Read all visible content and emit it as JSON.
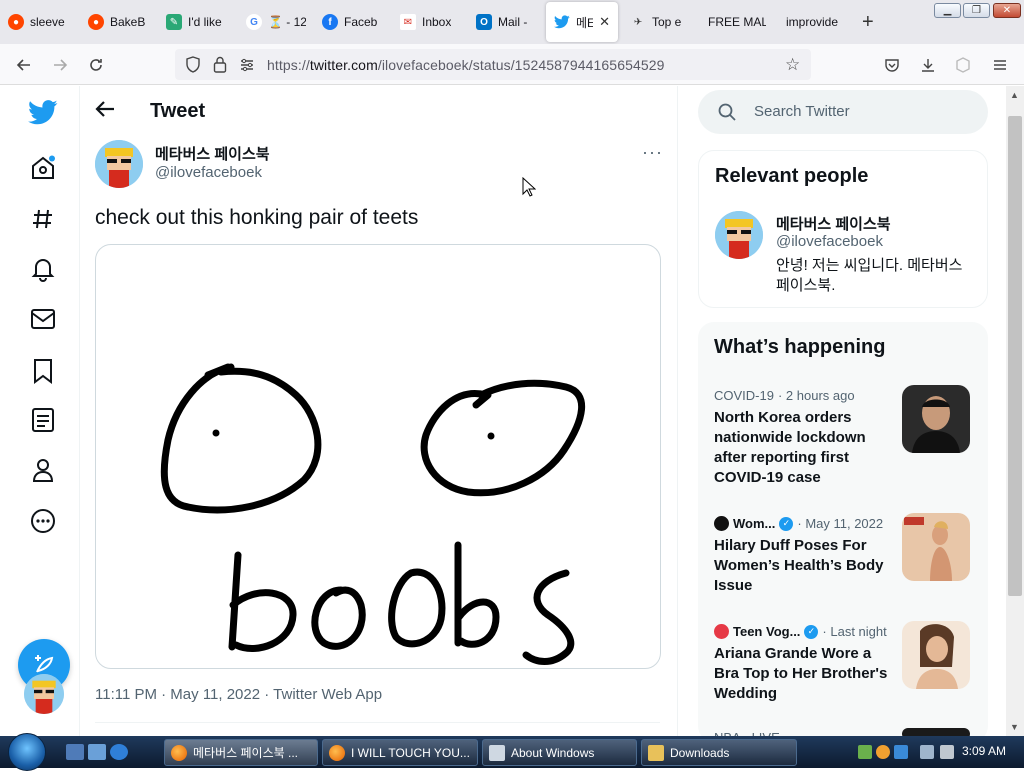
{
  "browser": {
    "tabs": [
      {
        "label": "sleeve",
        "color": "#ff4500"
      },
      {
        "label": "BakeB",
        "color": "#ff4500"
      },
      {
        "label": "I'd like",
        "color": "#2aa876"
      },
      {
        "label": "⏳ - 12",
        "color": "#4285f4"
      },
      {
        "label": "Faceb",
        "color": "#1877f2"
      },
      {
        "label": "Inbox",
        "color": "#d93025"
      },
      {
        "label": "Mail -",
        "color": "#0072c6"
      },
      {
        "label": "메E",
        "color": "#1d9bf0"
      },
      {
        "label": "Top e",
        "color": "#333333"
      },
      {
        "label": "FREE MAL",
        "color": ""
      },
      {
        "label": "improvide",
        "color": ""
      }
    ],
    "new_tab": "+",
    "url_prefix": "https://",
    "url_host": "twitter.com",
    "url_path": "/ilovefaceboek/status/1524587944165654529"
  },
  "twitter": {
    "header_title": "Tweet",
    "author_name": "메타버스 페이스북",
    "author_handle": "@ilovefaceboek",
    "tweet_text": "check out this honking pair of teets",
    "tweet_meta": "11:11 PM · May 11, 2022 · Twitter Web App",
    "more": "···",
    "search_placeholder": "Search Twitter",
    "relevant_title": "Relevant people",
    "relevant_person": {
      "name": "메타버스 페이스북",
      "handle": "@ilovefaceboek",
      "bio": "안녕! 저는 씨입니다. 메타버스 페이스북."
    },
    "happening_title": "What’s happening",
    "trends": [
      {
        "meta_source": "COVID-19",
        "meta_time": "· 2 hours ago",
        "verified": false,
        "headline": "North Korea orders nationwide lockdown after reporting first COVID-19 case"
      },
      {
        "meta_source": "Wom...",
        "meta_time": "· May 11, 2022",
        "verified": true,
        "headline": "Hilary Duff Poses For Women’s Health’s Body Issue"
      },
      {
        "meta_source": "Teen Vog...",
        "meta_time": "· Last night",
        "verified": true,
        "headline": "Ariana Grande Wore a Bra Top to Her Brother's Wedding"
      },
      {
        "meta_source": "NBA · LIVE",
        "meta_time": "",
        "verified": false,
        "headline": ""
      }
    ],
    "accent": "#1d9bf0"
  },
  "taskbar": {
    "tasks": [
      {
        "label": "메타버스 페이스북 ...",
        "active": true
      },
      {
        "label": "I WILL TOUCH YOU...",
        "active": false
      },
      {
        "label": "About Windows",
        "active": false
      },
      {
        "label": "Downloads",
        "active": false
      }
    ],
    "clock": "3:09 AM"
  }
}
